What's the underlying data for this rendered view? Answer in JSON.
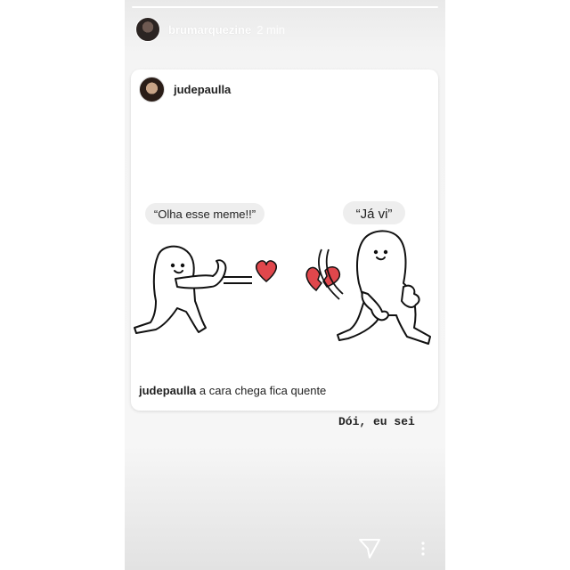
{
  "story": {
    "username": "brumarquezine",
    "time": "2 min",
    "avatar_icon": "profile-avatar"
  },
  "post": {
    "username": "judepaulla",
    "avatar_icon": "profile-avatar",
    "meme": {
      "left_bubble": "“Olha esse meme!!”",
      "right_bubble": "“Já vi”"
    },
    "caption_user": "judepaulla",
    "caption_text": " a cara chega fica quente"
  },
  "sticker_text": "Dói, eu sei",
  "actions": {
    "send_icon": "paper-plane-icon",
    "more_icon": "more-vertical-icon"
  },
  "colors": {
    "heart": "#e0474c",
    "bubble": "#eeeeee"
  }
}
